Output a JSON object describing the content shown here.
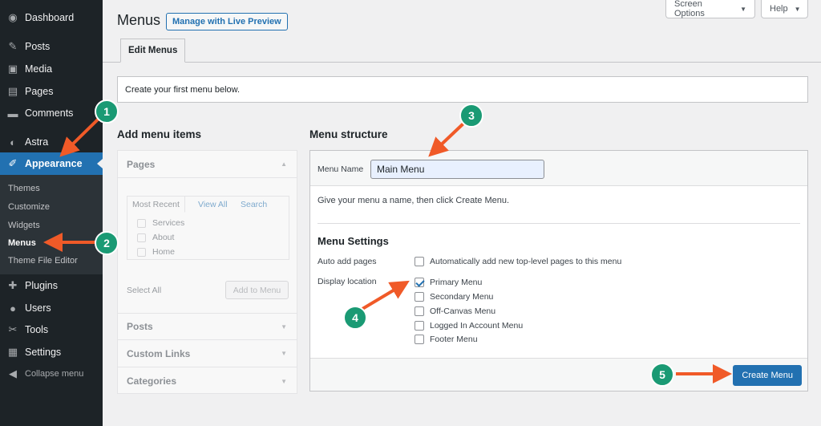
{
  "sidebar": {
    "items": [
      {
        "label": "Dashboard",
        "icon": "dashboard-icon",
        "glyph": "◉"
      },
      {
        "label": "Posts",
        "icon": "pin-icon",
        "glyph": "✎"
      },
      {
        "label": "Media",
        "icon": "media-icon",
        "glyph": "▣"
      },
      {
        "label": "Pages",
        "icon": "page-icon",
        "glyph": "▤"
      },
      {
        "label": "Comments",
        "icon": "comment-icon",
        "glyph": "▬"
      },
      {
        "label": "Astra",
        "icon": "astra-icon",
        "glyph": "◐"
      },
      {
        "label": "Appearance",
        "icon": "brush-icon",
        "glyph": "✐"
      },
      {
        "label": "Plugins",
        "icon": "plugin-icon",
        "glyph": "✚"
      },
      {
        "label": "Users",
        "icon": "user-icon",
        "glyph": "●"
      },
      {
        "label": "Tools",
        "icon": "wrench-icon",
        "glyph": "✂"
      },
      {
        "label": "Settings",
        "icon": "settings-icon",
        "glyph": "▦"
      },
      {
        "label": "Collapse menu",
        "icon": "collapse-icon",
        "glyph": "◀"
      }
    ],
    "submenu": [
      "Themes",
      "Customize",
      "Widgets",
      "Menus",
      "Theme File Editor"
    ]
  },
  "top": {
    "screen_options": "Screen Options",
    "help": "Help"
  },
  "header": {
    "title": "Menus",
    "live_preview": "Manage with Live Preview",
    "tab": "Edit Menus"
  },
  "notice": "Create your first menu below.",
  "add_items": {
    "heading": "Add menu items",
    "sections": [
      "Pages",
      "Posts",
      "Custom Links",
      "Categories"
    ],
    "tabs": [
      "Most Recent",
      "View All",
      "Search"
    ],
    "pages": [
      "Services",
      "About",
      "Home"
    ],
    "select_all": "Select All",
    "add_button": "Add to Menu"
  },
  "structure": {
    "heading": "Menu structure",
    "name_label": "Menu Name",
    "name_value": "Main Menu",
    "hint": "Give your menu a name, then click Create Menu.",
    "settings_heading": "Menu Settings",
    "auto_add_label": "Auto add pages",
    "auto_add_option": "Automatically add new top-level pages to this menu",
    "display_label": "Display location",
    "locations": [
      {
        "label": "Primary Menu",
        "checked": true
      },
      {
        "label": "Secondary Menu",
        "checked": false
      },
      {
        "label": "Off-Canvas Menu",
        "checked": false
      },
      {
        "label": "Logged In Account Menu",
        "checked": false
      },
      {
        "label": "Footer Menu",
        "checked": false
      }
    ],
    "create_button": "Create Menu"
  },
  "annotations": [
    "1",
    "2",
    "3",
    "4",
    "5"
  ],
  "colors": {
    "accent": "#2271b1",
    "arrow": "#f05a28",
    "badge": "#1a9a74",
    "sidebar": "#1d2327"
  }
}
